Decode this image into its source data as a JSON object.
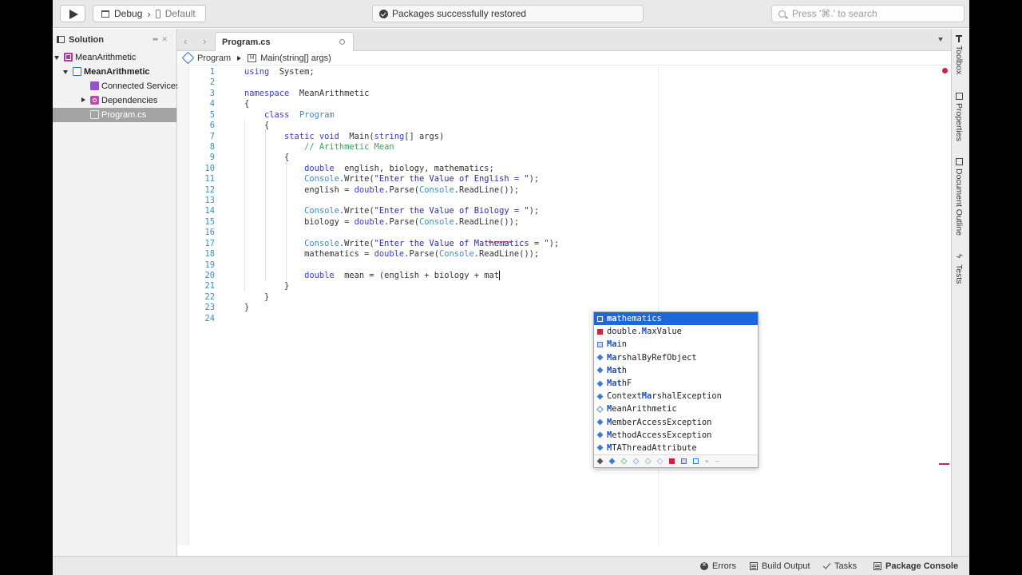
{
  "toolbar": {
    "config": "Debug",
    "device": "Default",
    "status": "Packages successfully restored",
    "search_placeholder": "Press '⌘.' to search"
  },
  "solution_pad": {
    "title": "Solution",
    "tree": [
      {
        "label": "MeanArithmetic",
        "icon": "solution-icon",
        "level": 0,
        "expanded": true,
        "bold": false
      },
      {
        "label": "MeanArithmetic",
        "icon": "project-icon",
        "level": 1,
        "expanded": true,
        "bold": true
      },
      {
        "label": "Connected Services",
        "icon": "connected-services-icon",
        "level": 2,
        "expanded": null,
        "bold": false
      },
      {
        "label": "Dependencies",
        "icon": "dependencies-icon",
        "level": 2,
        "expanded": false,
        "bold": false
      },
      {
        "label": "Program.cs",
        "icon": "csharp-file-icon",
        "level": 2,
        "expanded": null,
        "bold": false,
        "selected": true
      }
    ]
  },
  "editor": {
    "tab": "Program.cs",
    "path_class": "Program",
    "path_method": "Main(string[] args)",
    "lines": [
      {
        "n": "1",
        "segs": [
          [
            "kw",
            "using"
          ],
          [
            "",
            "  System;"
          ]
        ]
      },
      {
        "n": "2",
        "segs": []
      },
      {
        "n": "3",
        "segs": [
          [
            "kw",
            "namespace"
          ],
          [
            "",
            "  MeanArithmetic"
          ]
        ]
      },
      {
        "n": "4",
        "segs": [
          [
            "",
            "{"
          ]
        ]
      },
      {
        "n": "5",
        "segs": [
          [
            "",
            "    "
          ],
          [
            "kw",
            "class"
          ],
          [
            "",
            "  "
          ],
          [
            "type",
            "Program"
          ]
        ]
      },
      {
        "n": "6",
        "segs": [
          [
            "",
            "    {"
          ]
        ]
      },
      {
        "n": "7",
        "segs": [
          [
            "",
            "        "
          ],
          [
            "kw",
            "static void"
          ],
          [
            "",
            "  Main("
          ],
          [
            "kw",
            "string"
          ],
          [
            "",
            "[] args)"
          ]
        ]
      },
      {
        "n": "8",
        "segs": [
          [
            "",
            "            "
          ],
          [
            "cm",
            "// Arithmetic Mean"
          ]
        ]
      },
      {
        "n": "9",
        "segs": [
          [
            "",
            "        {"
          ]
        ]
      },
      {
        "n": "10",
        "segs": [
          [
            "",
            "            "
          ],
          [
            "kw",
            "double"
          ],
          [
            "",
            "  english, biology, mathematics;"
          ]
        ]
      },
      {
        "n": "11",
        "segs": [
          [
            "",
            "            "
          ],
          [
            "type",
            "Console"
          ],
          [
            "",
            ".Write("
          ],
          [
            "str",
            "\"Enter the Value of English = \""
          ],
          [
            "",
            ");"
          ]
        ]
      },
      {
        "n": "12",
        "segs": [
          [
            "",
            "            english = "
          ],
          [
            "kw",
            "double"
          ],
          [
            "",
            ".Parse("
          ],
          [
            "type",
            "Console"
          ],
          [
            "",
            ".ReadLine());"
          ]
        ]
      },
      {
        "n": "13",
        "segs": []
      },
      {
        "n": "14",
        "segs": [
          [
            "",
            "            "
          ],
          [
            "type",
            "Console"
          ],
          [
            "",
            ".Write("
          ],
          [
            "str",
            "\"Enter the Value of Biology = \""
          ],
          [
            "",
            ");"
          ]
        ]
      },
      {
        "n": "15",
        "segs": [
          [
            "",
            "            biology = "
          ],
          [
            "kw",
            "double"
          ],
          [
            "",
            ".Parse("
          ],
          [
            "type",
            "Console"
          ],
          [
            "",
            ".ReadLine());"
          ]
        ]
      },
      {
        "n": "16",
        "segs": []
      },
      {
        "n": "17",
        "segs": [
          [
            "",
            "            "
          ],
          [
            "type",
            "Console"
          ],
          [
            "",
            ".Write("
          ],
          [
            "str",
            "\"Enter the Value of Mathematics = \""
          ],
          [
            "",
            ");"
          ]
        ]
      },
      {
        "n": "18",
        "segs": [
          [
            "",
            "            mathematics = "
          ],
          [
            "kw",
            "double"
          ],
          [
            "",
            ".Parse("
          ],
          [
            "type",
            "Console"
          ],
          [
            "",
            ".ReadLine());"
          ]
        ]
      },
      {
        "n": "19",
        "segs": []
      },
      {
        "n": "20",
        "segs": [
          [
            "",
            "            "
          ],
          [
            "kw",
            "double"
          ],
          [
            "",
            "  mean = (english + biology + mat"
          ]
        ],
        "caret": true
      },
      {
        "n": "21",
        "segs": [
          [
            "",
            "        }"
          ]
        ]
      },
      {
        "n": "22",
        "segs": [
          [
            "",
            "    }"
          ]
        ]
      },
      {
        "n": "23",
        "segs": [
          [
            "",
            "}"
          ]
        ]
      },
      {
        "n": "24",
        "segs": []
      }
    ]
  },
  "completion": {
    "items": [
      {
        "pre": "",
        "match": "ma",
        "post": "thematics",
        "icon": "field-icon",
        "selected": true
      },
      {
        "pre": "double.",
        "match": "M",
        "post": "axValue",
        "icon": "constant-icon"
      },
      {
        "pre": "",
        "match": "Ma",
        "post": "in",
        "icon": "method-icon"
      },
      {
        "pre": "",
        "match": "Ma",
        "post": "rshalByRefObject",
        "icon": "class-icon"
      },
      {
        "pre": "",
        "match": "Mat",
        "post": "h",
        "icon": "class-icon"
      },
      {
        "pre": "",
        "match": "Mat",
        "post": "hF",
        "icon": "class-icon"
      },
      {
        "pre": "Context",
        "match": "Ma",
        "post": "rshalException",
        "icon": "class-icon"
      },
      {
        "pre": "",
        "match": "M",
        "post": "eanArithmetic",
        "icon": "namespace-icon"
      },
      {
        "pre": "",
        "match": "M",
        "post": "emberAccessException",
        "icon": "class-icon"
      },
      {
        "pre": "",
        "match": "M",
        "post": "ethodAccessException",
        "icon": "class-icon"
      },
      {
        "pre": "",
        "match": "M",
        "post": "TAThreadAttribute",
        "icon": "class-icon"
      }
    ]
  },
  "right_dock": [
    "Toolbox",
    "Properties",
    "Document Outline",
    "Tests"
  ],
  "statusbar": {
    "errors": "Errors",
    "build_output": "Build Output",
    "tasks": "Tasks",
    "package_console": "Package Console"
  },
  "colors": {
    "keyword": "#3a3ad0",
    "type": "#3a8fb8",
    "comment": "#3aa060",
    "selection": "#1a68dc",
    "error": "#c9253c"
  }
}
